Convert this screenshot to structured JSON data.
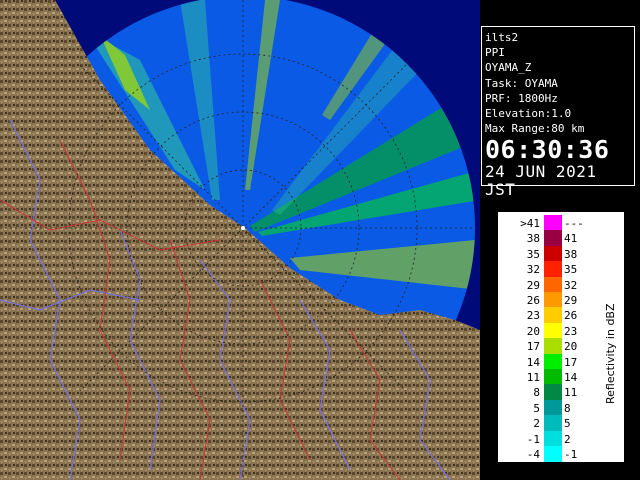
{
  "info": {
    "station": "ilts2",
    "product": "PPI",
    "radar_name": "OYAMA_Z",
    "task": "Task: OYAMA",
    "prf": "PRF: 1800Hz",
    "elevation": "Elevation:1.0",
    "max_range": "Max Range:80 km",
    "time": "06:30:36",
    "date": "24 JUN 2021 JST"
  },
  "legend": {
    "unit_label": "Reflectivity in dBZ",
    "rows": [
      {
        "low": ">41",
        "high": "---",
        "color": "#ff00ff"
      },
      {
        "low": "38",
        "high": "41",
        "color": "#990044"
      },
      {
        "low": "35",
        "high": "38",
        "color": "#cc0000"
      },
      {
        "low": "32",
        "high": "35",
        "color": "#ff2200"
      },
      {
        "low": "29",
        "high": "32",
        "color": "#ff6600"
      },
      {
        "low": "26",
        "high": "29",
        "color": "#ff9900"
      },
      {
        "low": "23",
        "high": "26",
        "color": "#ffcc00"
      },
      {
        "low": "20",
        "high": "23",
        "color": "#ffff00"
      },
      {
        "low": "17",
        "high": "20",
        "color": "#aadd00"
      },
      {
        "low": "14",
        "high": "17",
        "color": "#00ee00"
      },
      {
        "low": "11",
        "high": "14",
        "color": "#00bb00"
      },
      {
        "low": "8",
        "high": "11",
        "color": "#008844"
      },
      {
        "low": "5",
        "high": "8",
        "color": "#009999"
      },
      {
        "low": "2",
        "high": "5",
        "color": "#00bbbb"
      },
      {
        "low": "-1",
        "high": "2",
        "color": "#00dddd"
      },
      {
        "low": "-4",
        "high": "-1",
        "color": "#00ffff"
      }
    ]
  },
  "colors": {
    "sea": "#0a5ae6",
    "outside_range": "#000a78",
    "land": "#8a7350",
    "rivers": "#6f6fff",
    "roads": "#cc3333"
  }
}
